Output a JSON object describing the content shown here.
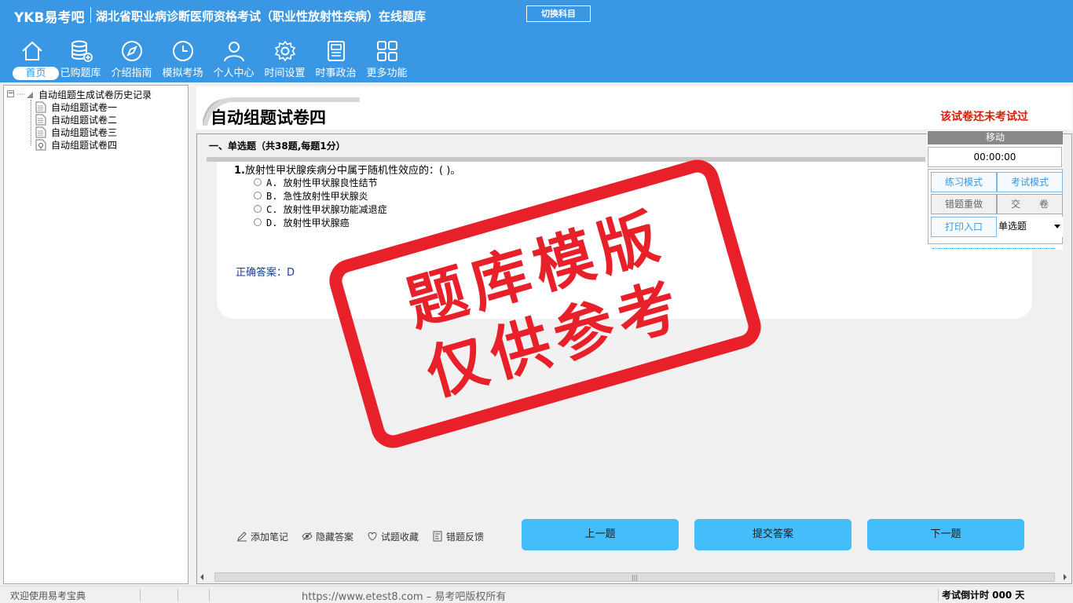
{
  "header": {
    "logo": "YKB易考吧",
    "app_title": "湖北省职业病诊断医师资格考试（职业性放射性疾病）在线题库",
    "switch_subject": "切换科目",
    "nav": [
      {
        "label": "首页",
        "icon": "home-icon",
        "active": true
      },
      {
        "label": "已购题库",
        "icon": "database-icon"
      },
      {
        "label": "介绍指南",
        "icon": "compass-icon"
      },
      {
        "label": "模拟考场",
        "icon": "clock-icon"
      },
      {
        "label": "个人中心",
        "icon": "user-icon"
      },
      {
        "label": "时间设置",
        "icon": "gear-icon"
      },
      {
        "label": "时事政治",
        "icon": "newspaper-icon"
      },
      {
        "label": "更多功能",
        "icon": "grid-icon"
      }
    ]
  },
  "tree": {
    "root_label": "自动组题生成试卷历史记录",
    "items": [
      "自动组题试卷一",
      "自动组题试卷二",
      "自动组题试卷三",
      "自动组题试卷四"
    ]
  },
  "paper": {
    "title": "自动组题试卷四",
    "status": "该试卷还未考试过",
    "section_header": "一、单选题（共38题,每题1分）"
  },
  "question": {
    "number": "1.",
    "text": "放射性甲状腺疾病分中属于随机性效应的：( )。",
    "options": [
      "A. 放射性甲状腺良性结节",
      "B. 急性放射性甲状腺炎",
      "C. 放射性甲状腺功能减退症",
      "D. 放射性甲状腺癌"
    ],
    "answer": "正确答案：D"
  },
  "right_panel": {
    "move": "移动",
    "timer": "00:00:00",
    "practice_mode": "练习模式",
    "exam_mode": "考试模式",
    "redo_wrong": "错题重做",
    "submit_paper": "交　　卷",
    "print_entry": "打印入口",
    "question_type": "单选题"
  },
  "tools": {
    "add_note": "添加笔记",
    "hide_answer": "隐藏答案",
    "favorite": "试题收藏",
    "report_error": "错题反馈"
  },
  "nav_buttons": {
    "prev": "上一题",
    "submit_answer": "提交答案",
    "next": "下一题"
  },
  "status_bar": {
    "welcome": "欢迎使用易考宝典",
    "copyright": "https://www.etest8.com – 易考吧版权所有",
    "countdown": "考试倒计时 000 天"
  },
  "watermark": {
    "line1": "题库模版",
    "line2": "仅供参考"
  },
  "colors": {
    "header_bg": "#3a97e4",
    "stamp_red": "#e8202a",
    "status_red": "#d81e06",
    "nav_button": "#44bdfb",
    "answer_blue": "#1a3c9e"
  }
}
